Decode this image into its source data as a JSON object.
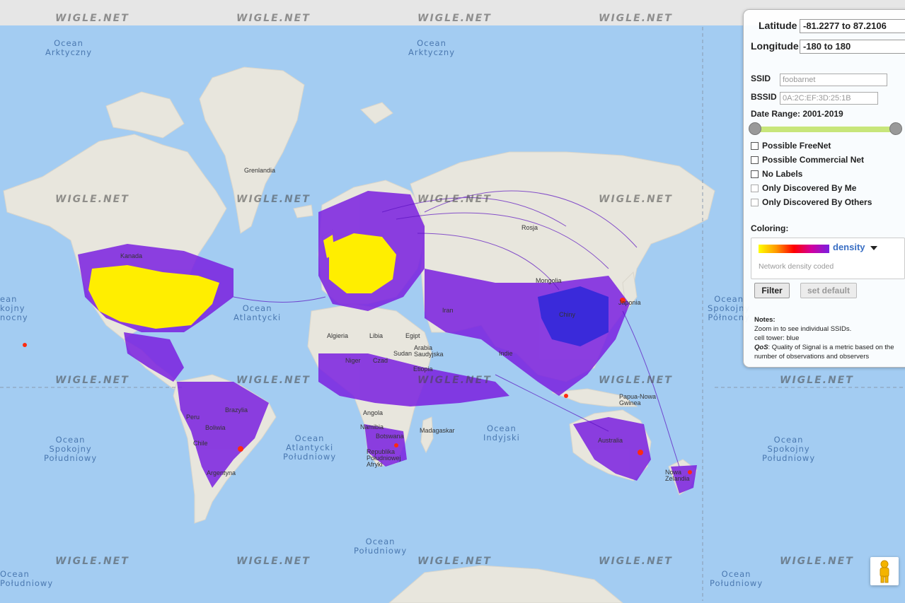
{
  "map": {
    "watermark_text": "WIGLE.NET",
    "ocean_labels": [
      {
        "id": "arctic-west",
        "text": "Ocean\nArktyczny"
      },
      {
        "id": "arctic-east",
        "text": "Ocean\nArktyczny"
      },
      {
        "id": "pacific-north-west",
        "text": "ean\nkojny\nnocny"
      },
      {
        "id": "atlantic-north",
        "text": "Ocean\nAtlantycki"
      },
      {
        "id": "pacific-north-east",
        "text": "Ocean\nSpokojny\nPółnocny"
      },
      {
        "id": "pacific-south-west",
        "text": "Ocean\nSpokojny\nPołudniowy"
      },
      {
        "id": "atlantic-south",
        "text": "Ocean\nAtlantycki\nPołudniowy"
      },
      {
        "id": "indian",
        "text": "Ocean\nIndyjski"
      },
      {
        "id": "pacific-south-east",
        "text": "Ocean\nSpokojny\nPołudniowy"
      },
      {
        "id": "southern-center",
        "text": "Ocean\nPołudniowy"
      },
      {
        "id": "southern-west",
        "text": "Ocean\nPołudniowy"
      },
      {
        "id": "southern-east",
        "text": "Ocean\nPołudniowy"
      }
    ],
    "country_labels": [
      "Grenlandia",
      "Kanada",
      "Rosja",
      "Mongolia",
      "Chiny",
      "Indie",
      "Algieria",
      "Libia",
      "Egipt",
      "Niger",
      "Czad",
      "Sudan",
      "Etiopia",
      "Angola",
      "Namibia",
      "Botswana",
      "Madagaskar",
      "Republika\nPołudniowej\nAfryki",
      "Brazylia",
      "Peru",
      "Boliwia",
      "Chile",
      "Argentyna",
      "Australia",
      "Papua-Nowa\nGwinea",
      "Nowa\nZelandia",
      "Iran",
      "Arabia\nSaudyjska",
      "Japonia"
    ]
  },
  "panel": {
    "latitude_label": "Latitude",
    "latitude_value": "-81.2277 to 87.2106",
    "longitude_label": "Longitude",
    "longitude_value": "-180 to 180",
    "ssid_label": "SSID",
    "ssid_placeholder": "foobarnet",
    "bssid_label": "BSSID",
    "bssid_placeholder": "0A:2C:EF:3D:25:1B",
    "date_range_label": "Date Range: 2001-2019",
    "checkboxes": [
      {
        "label": "Possible FreeNet",
        "checked": false
      },
      {
        "label": "Possible Commercial Net",
        "checked": false
      },
      {
        "label": "No Labels",
        "checked": false
      },
      {
        "label": "Only Discovered By Me",
        "checked": false
      },
      {
        "label": "Only Discovered By Others",
        "checked": false
      }
    ],
    "coloring_label": "Coloring:",
    "coloring_value": "density",
    "coloring_description": "Network density coded",
    "filter_button": "Filter",
    "set_default_button": "set default",
    "notes_title": "Notes:",
    "notes_line1": "Zoom in to see individual SSIDs.",
    "notes_line2": "cell tower: blue",
    "notes_qos_term": "QoS",
    "notes_qos_text": ": Quality of Signal is a metric based on the number of observations and observers"
  },
  "colors": {
    "ocean": "#a3ccf2",
    "land": "#e9e6df",
    "density_low": "#7a20e0",
    "density_high": "#ffff00",
    "cell_tower": "#2020e0",
    "slider_track": "#c8e67a",
    "link": "#3a6fc4"
  },
  "icons": {
    "pegman": "pegman-icon",
    "dropdown": "caret-down-icon"
  }
}
